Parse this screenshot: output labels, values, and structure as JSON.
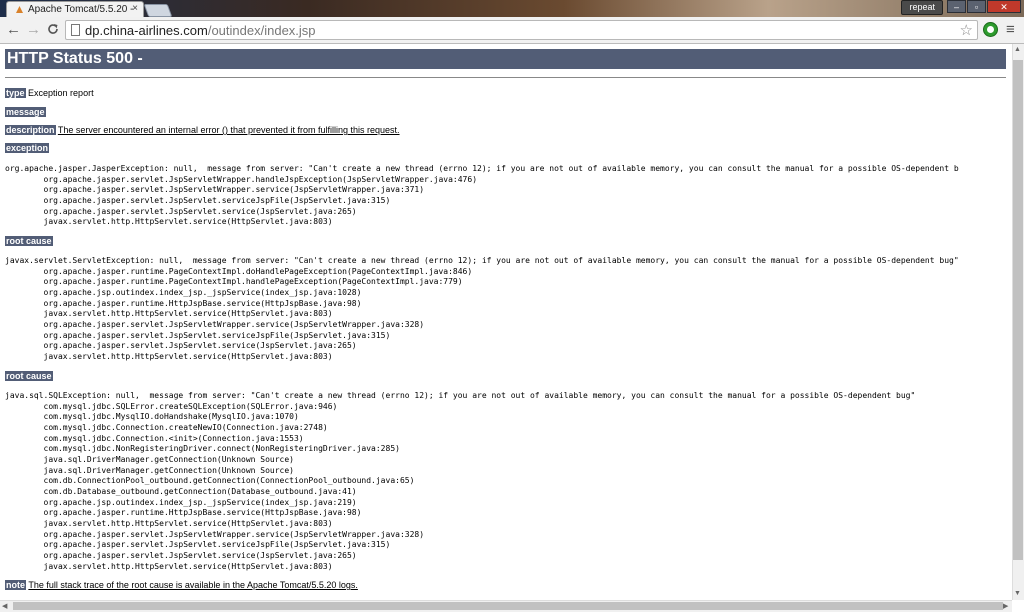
{
  "browser": {
    "tab_title": "Apache Tomcat/5.5.20 -",
    "tab_close": "×",
    "repeat_label": "repeat",
    "url_host": "dp.china-airlines.com",
    "url_path": "/outindex/index.jsp",
    "back_icon": "←",
    "forward_icon": "→",
    "reload_icon": "C",
    "star_icon": "☆",
    "menu_icon": "≡"
  },
  "page": {
    "title": "HTTP Status 500 -",
    "type_label": "type",
    "type_value": "Exception report",
    "message_label": "message",
    "description_label": "description",
    "description_value": "The server encountered an internal error () that prevented it from fulfilling this request.",
    "exception_label": "exception",
    "exception_trace": "org.apache.jasper.JasperException: null,  message from server: \"Can't create a new thread (errno 12); if you are not out of available memory, you can consult the manual for a possible OS-dependent b\n\torg.apache.jasper.servlet.JspServletWrapper.handleJspException(JspServletWrapper.java:476)\n\torg.apache.jasper.servlet.JspServletWrapper.service(JspServletWrapper.java:371)\n\torg.apache.jasper.servlet.JspServlet.serviceJspFile(JspServlet.java:315)\n\torg.apache.jasper.servlet.JspServlet.service(JspServlet.java:265)\n\tjavax.servlet.http.HttpServlet.service(HttpServlet.java:803)",
    "root_cause_label_1": "root cause",
    "root_cause_trace_1": "javax.servlet.ServletException: null,  message from server: \"Can't create a new thread (errno 12); if you are not out of available memory, you can consult the manual for a possible OS-dependent bug\"\n\torg.apache.jasper.runtime.PageContextImpl.doHandlePageException(PageContextImpl.java:846)\n\torg.apache.jasper.runtime.PageContextImpl.handlePageException(PageContextImpl.java:779)\n\torg.apache.jsp.outindex.index_jsp._jspService(index_jsp.java:1028)\n\torg.apache.jasper.runtime.HttpJspBase.service(HttpJspBase.java:98)\n\tjavax.servlet.http.HttpServlet.service(HttpServlet.java:803)\n\torg.apache.jasper.servlet.JspServletWrapper.service(JspServletWrapper.java:328)\n\torg.apache.jasper.servlet.JspServlet.serviceJspFile(JspServlet.java:315)\n\torg.apache.jasper.servlet.JspServlet.service(JspServlet.java:265)\n\tjavax.servlet.http.HttpServlet.service(HttpServlet.java:803)",
    "root_cause_label_2": "root cause",
    "root_cause_trace_2": "java.sql.SQLException: null,  message from server: \"Can't create a new thread (errno 12); if you are not out of available memory, you can consult the manual for a possible OS-dependent bug\"\n\tcom.mysql.jdbc.SQLError.createSQLException(SQLError.java:946)\n\tcom.mysql.jdbc.MysqlIO.doHandshake(MysqlIO.java:1070)\n\tcom.mysql.jdbc.Connection.createNewIO(Connection.java:2748)\n\tcom.mysql.jdbc.Connection.<init>(Connection.java:1553)\n\tcom.mysql.jdbc.NonRegisteringDriver.connect(NonRegisteringDriver.java:285)\n\tjava.sql.DriverManager.getConnection(Unknown Source)\n\tjava.sql.DriverManager.getConnection(Unknown Source)\n\tcom.db.ConnectionPool_outbound.getConnection(ConnectionPool_outbound.java:65)\n\tcom.db.Database_outbound.getConnection(Database_outbound.java:41)\n\torg.apache.jsp.outindex.index_jsp._jspService(index_jsp.java:219)\n\torg.apache.jasper.runtime.HttpJspBase.service(HttpJspBase.java:98)\n\tjavax.servlet.http.HttpServlet.service(HttpServlet.java:803)\n\torg.apache.jasper.servlet.JspServletWrapper.service(JspServletWrapper.java:328)\n\torg.apache.jasper.servlet.JspServlet.serviceJspFile(JspServlet.java:315)\n\torg.apache.jasper.servlet.JspServlet.service(JspServlet.java:265)\n\tjavax.servlet.http.HttpServlet.service(HttpServlet.java:803)",
    "note_label": "note",
    "note_value": "The full stack trace of the root cause is available in the Apache Tomcat/5.5.20 logs."
  },
  "colors": {
    "heading_bg": "#525d76",
    "heading_text": "#ffffff"
  }
}
